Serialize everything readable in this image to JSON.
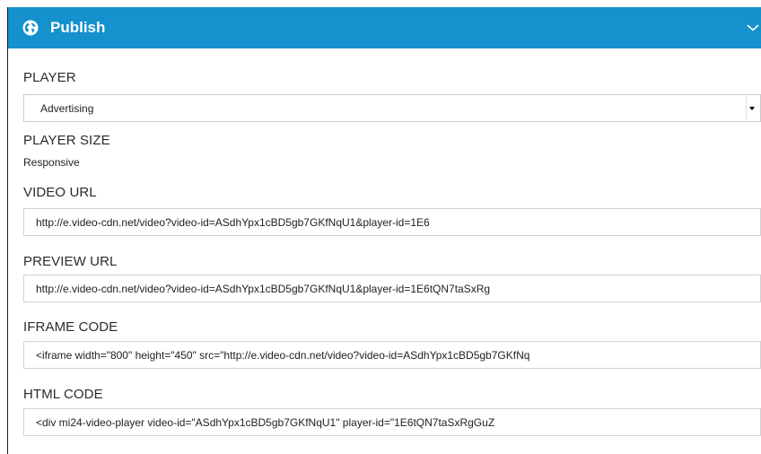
{
  "header": {
    "title": "Publish",
    "icon": "globe-icon",
    "collapse_icon": "chevron-down-icon",
    "background": "#1591cd"
  },
  "player": {
    "label": "PLAYER",
    "selected": "Advertising"
  },
  "player_size": {
    "label": "PLAYER SIZE",
    "value": "Responsive"
  },
  "video_url": {
    "label": "VIDEO URL",
    "value": "http://e.video-cdn.net/video?video-id=ASdhYpx1cBD5gb7GKfNqU1&player-id=1E6"
  },
  "preview_url": {
    "label": "PREVIEW URL",
    "value": "http://e.video-cdn.net/video?video-id=ASdhYpx1cBD5gb7GKfNqU1&player-id=1E6tQN7taSxRg"
  },
  "iframe_code": {
    "label": "IFRAME CODE",
    "value": "<iframe width=\"800\" height=\"450\" src=\"http://e.video-cdn.net/video?video-id=ASdhYpx1cBD5gb7GKfNq"
  },
  "html_code": {
    "label": "HTML CODE",
    "value": "<div mi24-video-player video-id=\"ASdhYpx1cBD5gb7GKfNqU1\" player-id=\"1E6tQN7taSxRgGuZ"
  }
}
